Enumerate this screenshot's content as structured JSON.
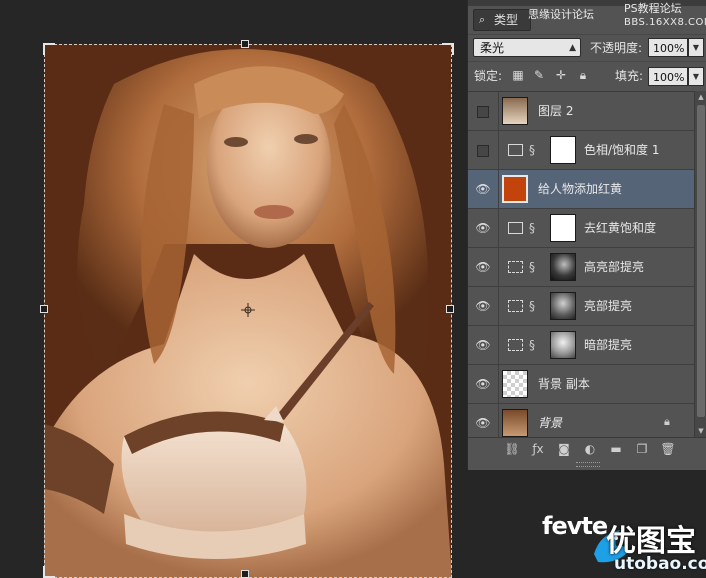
{
  "watermark": {
    "line1": "思缘设计论坛",
    "line2": "PS教程论坛",
    "line3": "BBS.16XX8.COM"
  },
  "layers_panel": {
    "filter_kind": {
      "icon": "search-icon",
      "label": "类型"
    },
    "blend_mode": "柔光",
    "opacity_label": "不透明度:",
    "opacity_value": "100%",
    "lock_label": "锁定:",
    "fill_label": "填充:",
    "fill_value": "100%",
    "layers": [
      {
        "name": "图层 2",
        "visible": false,
        "type": "pixel"
      },
      {
        "name": "色相/饱和度 1",
        "visible": false,
        "type": "adjustment"
      },
      {
        "name": "给人物添加红黄",
        "visible": true,
        "type": "color-fill",
        "selected": true,
        "color": "#c2430c"
      },
      {
        "name": "去红黄饱和度",
        "visible": true,
        "type": "adjustment"
      },
      {
        "name": "高亮部提亮",
        "visible": true,
        "type": "curves"
      },
      {
        "name": "亮部提亮",
        "visible": true,
        "type": "curves"
      },
      {
        "name": "暗部提亮",
        "visible": true,
        "type": "curves"
      },
      {
        "name": "背景 副本",
        "visible": true,
        "type": "transparent"
      },
      {
        "name": "背景",
        "visible": true,
        "type": "background",
        "locked": true
      }
    ]
  },
  "logo": {
    "latin": "fevte",
    "cn": "优图宝",
    "url": "utobao.com"
  },
  "colors": {
    "panel_bg": "#535353",
    "selected_row": "#566478",
    "fill_color": "#c2430c"
  }
}
